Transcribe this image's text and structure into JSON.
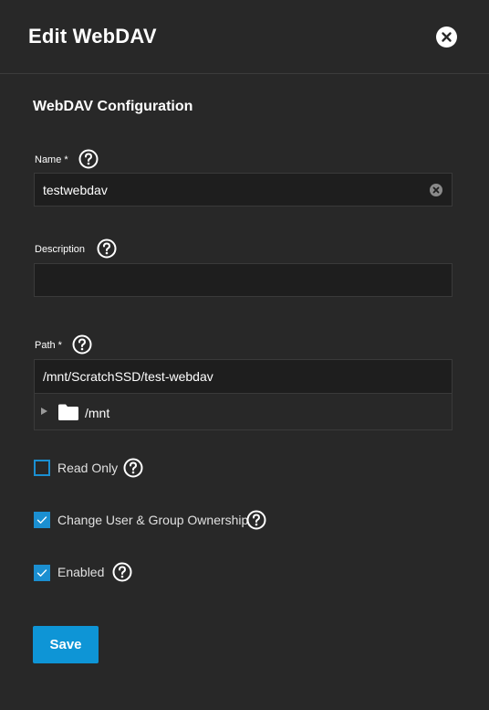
{
  "header": {
    "title": "Edit WebDAV",
    "close_icon": "close-icon"
  },
  "section": {
    "title": "WebDAV Configuration"
  },
  "fields": {
    "name": {
      "label": "Name *",
      "value": "testwebdav",
      "help_icon": "help-icon",
      "clear_icon": "clear-icon"
    },
    "description": {
      "label": "Description",
      "value": "",
      "help_icon": "help-icon"
    },
    "path": {
      "label": "Path *",
      "value": "/mnt/ScratchSSD/test-webdav",
      "help_icon": "help-icon",
      "tree": {
        "expand_icon": "triangle-right-icon",
        "folder_icon": "folder-icon",
        "node_label": "/mnt"
      }
    }
  },
  "checkboxes": [
    {
      "label": "Read Only",
      "checked": false
    },
    {
      "label": "Change User & Group Ownership",
      "checked": true
    },
    {
      "label": "Enabled",
      "checked": true
    }
  ],
  "actions": {
    "save_label": "Save"
  },
  "colors": {
    "background": "#282828",
    "input_background": "#1e1e1e",
    "accent": "#0e95d6",
    "checkbox": "#1b8fd1",
    "text": "#ffffff"
  }
}
